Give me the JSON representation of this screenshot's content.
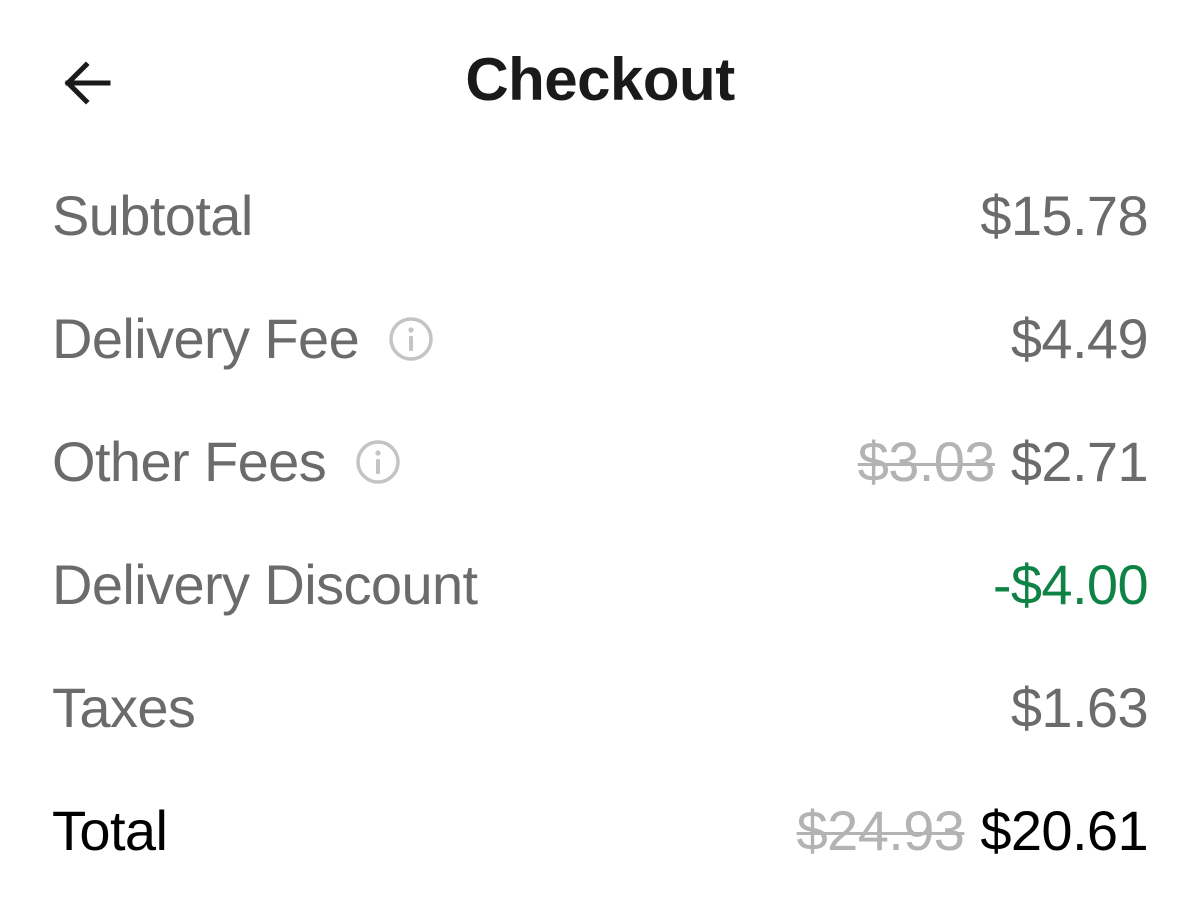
{
  "header": {
    "title": "Checkout",
    "back_icon": "arrow-left-icon"
  },
  "colors": {
    "title": "#1a1a1a",
    "label": "#6b6b6b",
    "strikethrough": "#b3b3b3",
    "discount": "#0e8345",
    "total": "#000000",
    "info_icon": "#c4c4c4"
  },
  "rows": {
    "subtotal": {
      "label": "Subtotal",
      "value": "$15.78"
    },
    "delivery_fee": {
      "label": "Delivery Fee",
      "value": "$4.49",
      "icon": "info-icon"
    },
    "other_fees": {
      "label": "Other Fees",
      "original_value": "$3.03",
      "value": "$2.71",
      "icon": "info-icon"
    },
    "delivery_discount": {
      "label": "Delivery Discount",
      "value": "-$4.00"
    },
    "taxes": {
      "label": "Taxes",
      "value": "$1.63"
    },
    "total": {
      "label": "Total",
      "original_value": "$24.93",
      "value": "$20.61"
    }
  }
}
